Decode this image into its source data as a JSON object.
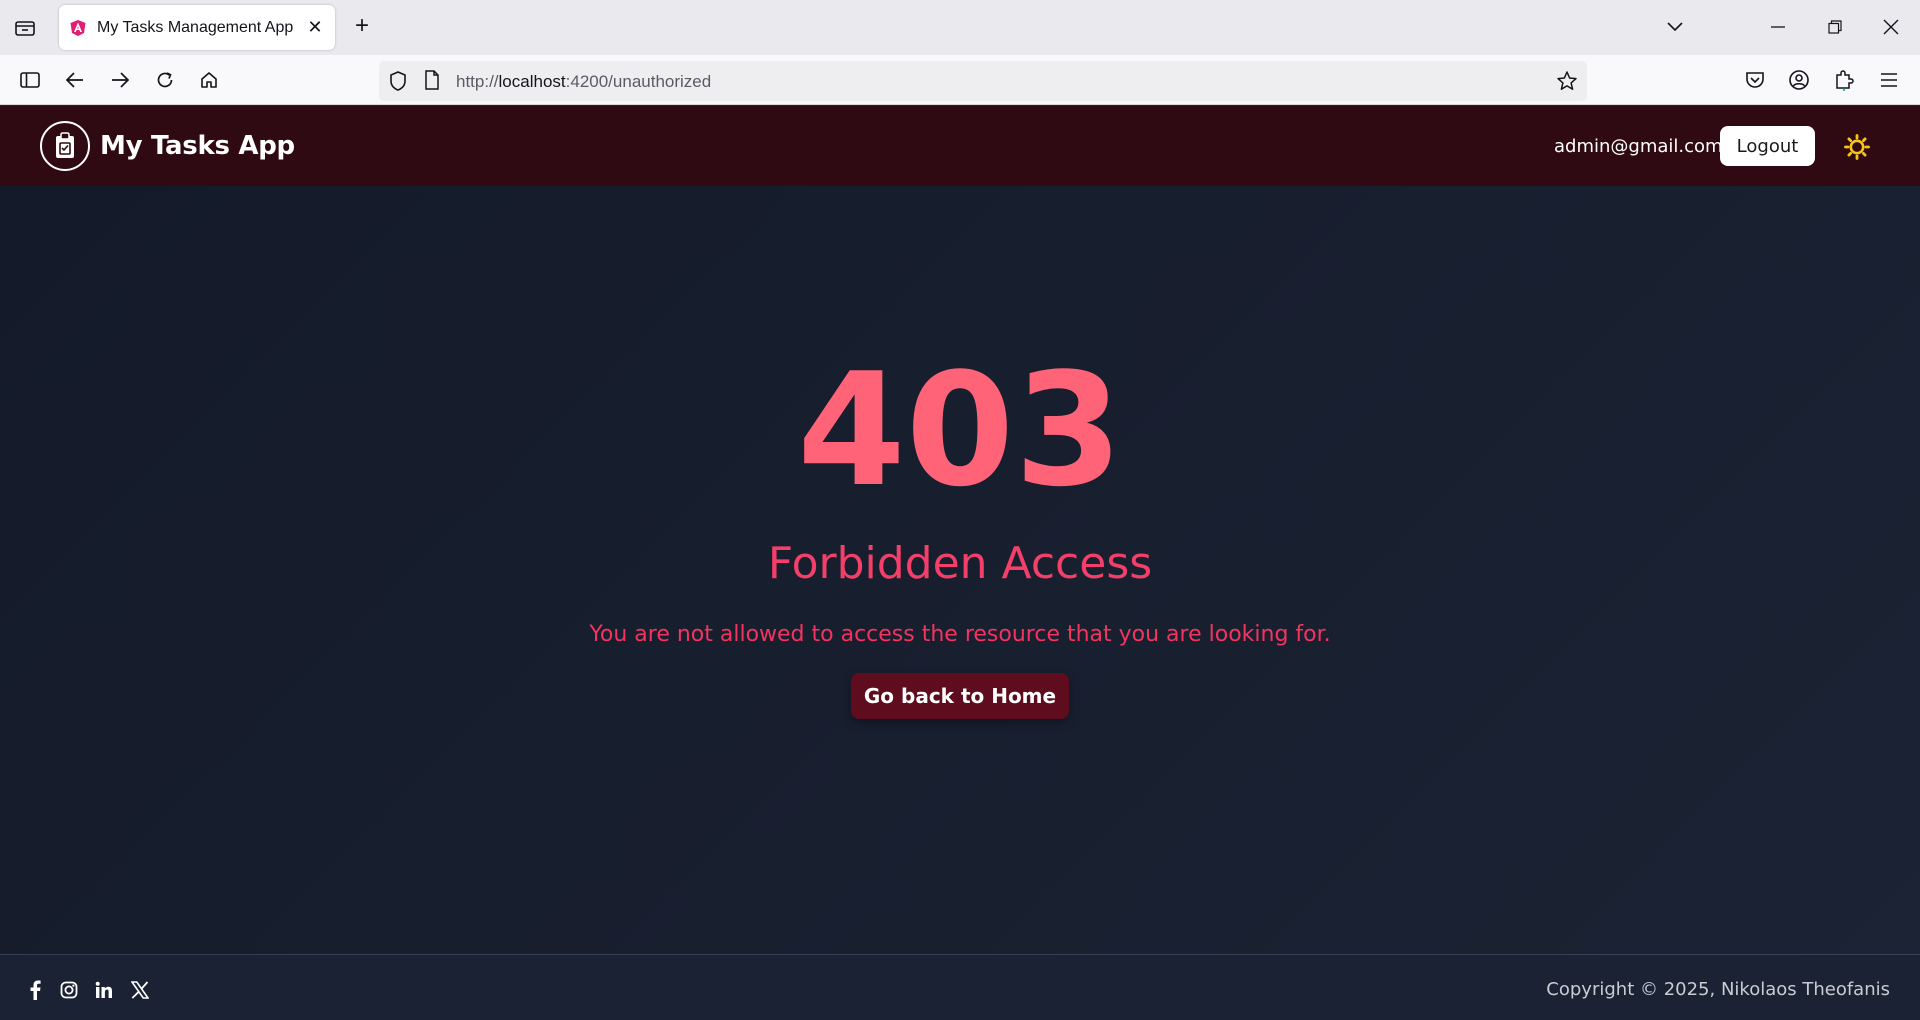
{
  "browser": {
    "tab_title": "My Tasks Management App",
    "new_tab_label": "+",
    "url_scheme": "http://",
    "url_host": "localhost",
    "url_path": ":4200/unauthorized"
  },
  "header": {
    "brand": "My Tasks App",
    "user_email": "admin@gmail.com",
    "logout_label": "Logout"
  },
  "error": {
    "code": "403",
    "title": "Forbidden Access",
    "message": "You are not allowed to access the resource that you are looking for.",
    "home_button_label": "Go back to Home"
  },
  "footer": {
    "socials": [
      "facebook-icon",
      "instagram-icon",
      "linkedin-icon",
      "x-icon"
    ],
    "copyright": "Copyright © 2025, Nikolaos Theofanis"
  },
  "colors": {
    "header_bg": "#300a12",
    "accent": "#ff6378",
    "button_bg": "#5e0c1e",
    "theme_icon": "#f7c518"
  }
}
